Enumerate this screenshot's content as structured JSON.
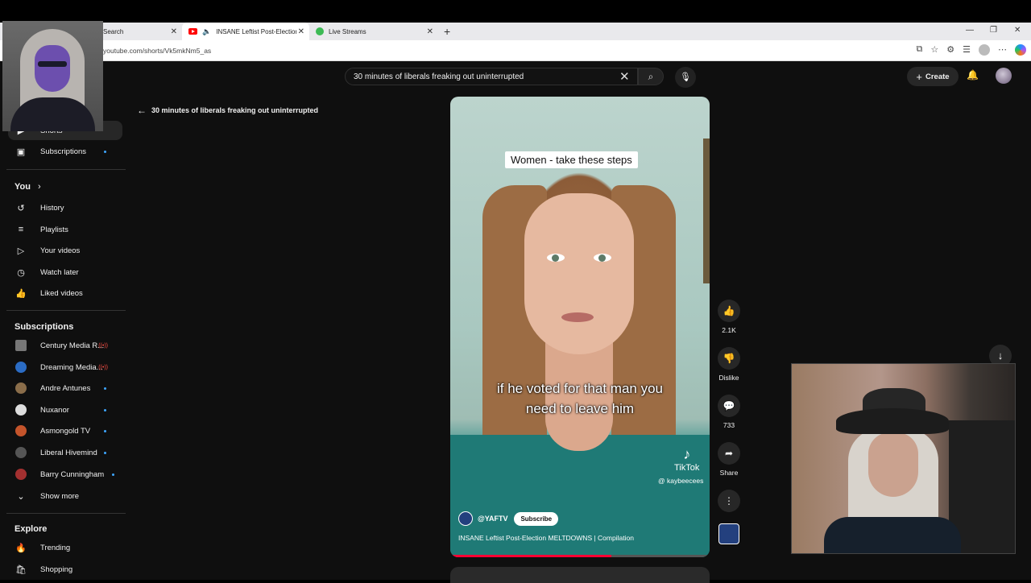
{
  "browser": {
    "tabs": [
      {
        "title": "Search"
      },
      {
        "title": "INSANE Leftist Post-Election"
      },
      {
        "title": "Live Streams"
      }
    ],
    "url": "youtube.com/shorts/Vk5mkNm5_as"
  },
  "header": {
    "search_query": "30 minutes of liberals freaking out uninterrupted",
    "create_label": "Create"
  },
  "sidebar": {
    "top_item": "Shorts",
    "subscriptions_top": "Subscriptions",
    "you_heading": "You",
    "you_items": [
      {
        "label": "History",
        "icon": "history-icon"
      },
      {
        "label": "Playlists",
        "icon": "playlists-icon"
      },
      {
        "label": "Your videos",
        "icon": "your-videos-icon"
      },
      {
        "label": "Watch later",
        "icon": "watch-later-icon"
      },
      {
        "label": "Liked videos",
        "icon": "liked-videos-icon"
      }
    ],
    "subscriptions_heading": "Subscriptions",
    "subscriptions": [
      {
        "label": "Century Media R...",
        "live": true,
        "color": "#777777"
      },
      {
        "label": "Dreaming Media...",
        "live": true,
        "color": "#2b6cc4"
      },
      {
        "label": "Andre Antunes",
        "live": false,
        "color": "#8a6d4a"
      },
      {
        "label": "Nuxanor",
        "live": false,
        "color": "#dddddd"
      },
      {
        "label": "Asmongold TV",
        "live": false,
        "color": "#c4542b"
      },
      {
        "label": "Liberal Hivemind",
        "live": false,
        "color": "#555555"
      },
      {
        "label": "Barry Cunningham",
        "live": false,
        "color": "#a33030"
      }
    ],
    "show_more": "Show more",
    "explore_heading": "Explore",
    "explore_items": [
      {
        "label": "Trending",
        "icon": "trending-icon"
      },
      {
        "label": "Shopping",
        "icon": "shopping-icon"
      }
    ]
  },
  "player": {
    "back_title": "30 minutes of liberals freaking out uninterrupted",
    "caption_top": "Women - take these steps",
    "caption_mid_1": "if he voted for that man you",
    "caption_mid_2": "need to leave him",
    "watermark": "TikTok",
    "watermark_user": "@ kaybeecees",
    "channel": "@YAFTV",
    "subscribe_label": "Subscribe",
    "video_title": "INSANE Leftist Post-Election MELTDOWNS | Compilation",
    "progress": 0.62
  },
  "actions": {
    "likes": "2.1K",
    "dislike_label": "Dislike",
    "comments": "733",
    "share_label": "Share"
  }
}
